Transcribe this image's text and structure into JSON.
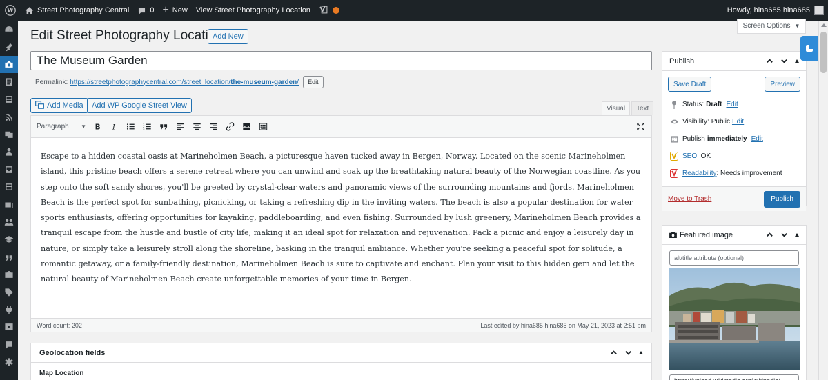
{
  "adminbar": {
    "site_name": "Street Photography Central",
    "comments_count": "0",
    "new_label": "New",
    "view_label": "View Street Photography Location",
    "greeting": "Howdy, hina685 hina685"
  },
  "screen_options": "Screen Options",
  "page": {
    "title": "Edit Street Photography Location",
    "add_new": "Add New"
  },
  "post": {
    "title": "The Museum Garden",
    "permalink_label": "Permalink:",
    "permalink_base": "https://streetphotographycentral.com/street_location/",
    "permalink_slug": "the-museum-garden",
    "permalink_end": "/",
    "edit_label": "Edit"
  },
  "media_buttons": {
    "add_media": "Add Media",
    "street_view": "Add WP Google Street View"
  },
  "editor_tabs": {
    "visual": "Visual",
    "text": "Text"
  },
  "toolbar": {
    "format": "Paragraph"
  },
  "content": "Escape to a hidden coastal oasis at Marineholmen Beach, a picturesque haven tucked away in Bergen, Norway. Located on the scenic Marineholmen island, this pristine beach offers a serene retreat where you can unwind and soak up the breathtaking natural beauty of the Norwegian coastline. As you step onto the soft sandy shores, you'll be greeted by crystal-clear waters and panoramic views of the surrounding mountains and fjords. Marineholmen Beach is the perfect spot for sunbathing, picnicking, or taking a refreshing dip in the inviting waters. The beach is also a popular destination for water sports enthusiasts, offering opportunities for kayaking, paddleboarding, and even fishing. Surrounded by lush greenery, Marineholmen Beach provides a tranquil escape from the hustle and bustle of city life, making it an ideal spot for relaxation and rejuvenation. Pack a picnic and enjoy a leisurely day in nature, or simply take a leisurely stroll along the shoreline, basking in the tranquil ambiance. Whether you're seeking a peaceful spot for solitude, a romantic getaway, or a family-friendly destination, Marineholmen Beach is sure to captivate and enchant. Plan your visit to this hidden gem and let the natural beauty of Marineholmen Beach create unforgettable memories of your time in Bergen.",
  "status_bar": {
    "word_count": "Word count: 202",
    "last_edited": "Last edited by hina685 hina685 on May 21, 2023 at 2:51 pm"
  },
  "geolocation": {
    "title": "Geolocation fields",
    "map_location": "Map Location"
  },
  "publish": {
    "title": "Publish",
    "save_draft": "Save Draft",
    "preview": "Preview",
    "status_label": "Status:",
    "status_value": "Draft",
    "visibility_label": "Visibility:",
    "visibility_value": "Public",
    "publish_label": "Publish",
    "publish_value": "immediately",
    "seo_label": "SEO",
    "seo_value": ": OK",
    "readability_label": "Readability",
    "readability_value": ": Needs improvement",
    "edit_link": "Edit",
    "move_to_trash": "Move to Trash",
    "publish_button": "Publish"
  },
  "featured_image": {
    "title": "Featured image",
    "alt_placeholder": "alt/title attribute (optional)",
    "url_value": "https://upload.wikimedia.org/wikipedia/"
  },
  "colors": {
    "adminbar_bg": "#1d2327",
    "accent": "#2271b1",
    "yoast_orange": "#e97a23",
    "trash_red": "#b32d2e"
  }
}
